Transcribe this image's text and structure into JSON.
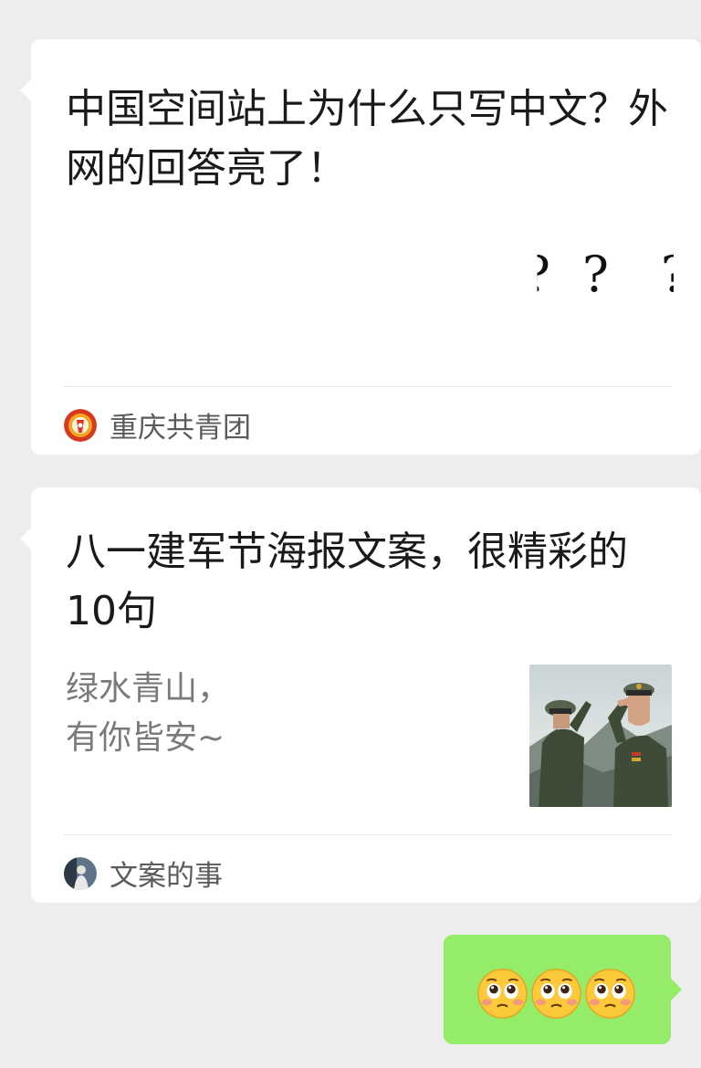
{
  "messages": [
    {
      "type": "article-card",
      "title": "中国空间站上为什么只写中文？外网的回答亮了！",
      "thumbnail_text": "? ? ?",
      "source": "重庆共青团",
      "source_icon": "youth-league-avatar-icon"
    },
    {
      "type": "article-card",
      "title": "八一建军节海报文案，很精彩的10句",
      "summary_lines": [
        "绿水青山，",
        "有你皆安~"
      ],
      "thumbnail_icon": "saluting-soldiers-photo",
      "source": "文案的事",
      "source_icon": "person-avatar-icon"
    }
  ],
  "outgoing": {
    "emojis": [
      "pleading-face-icon",
      "pleading-face-icon",
      "pleading-face-icon"
    ]
  },
  "colors": {
    "background": "#ededed",
    "card": "#ffffff",
    "outgoing_bubble": "#95ec69"
  }
}
